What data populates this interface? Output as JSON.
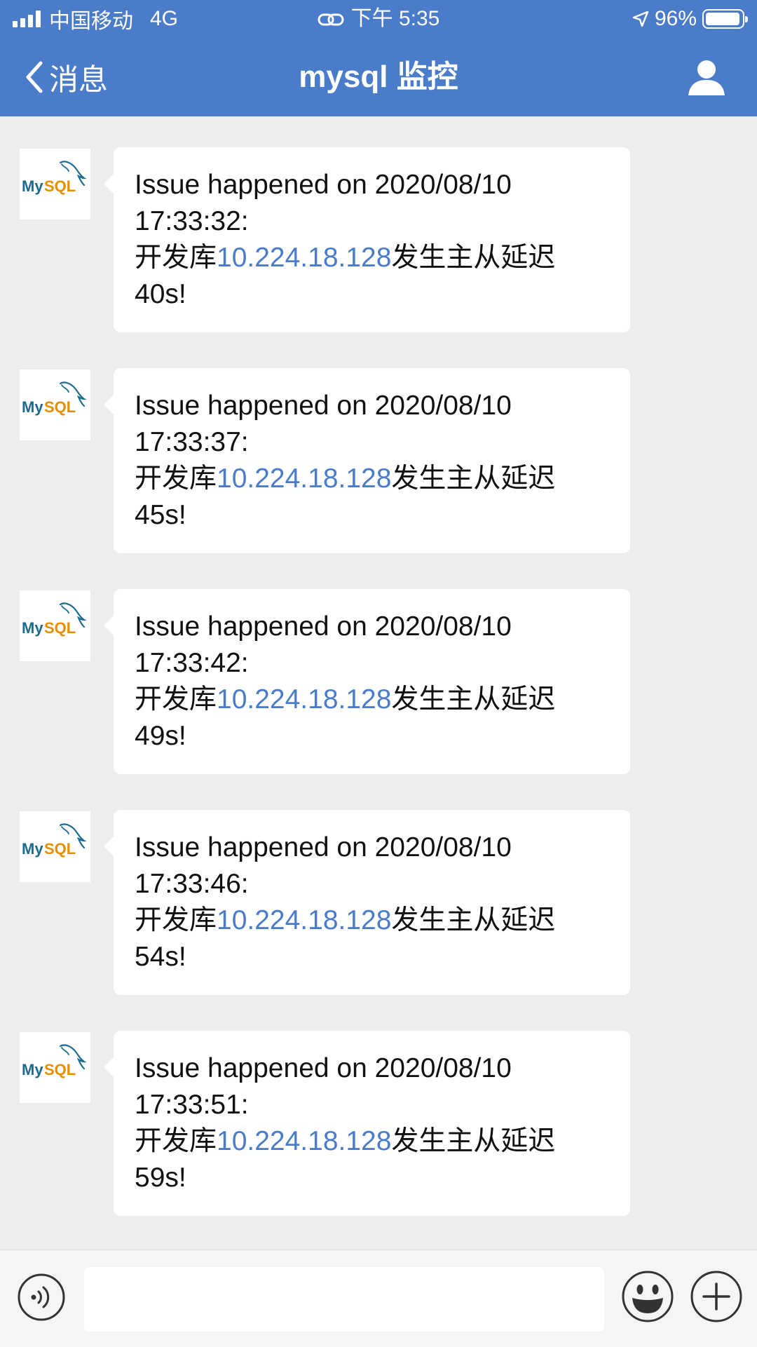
{
  "status_bar": {
    "carrier": "中国移动",
    "network": "4G",
    "time": "下午 5:35",
    "battery": "96%",
    "battery_level": 0.96
  },
  "nav": {
    "back_label": "消息",
    "title": "mysql 监控"
  },
  "avatar_text": "MySQL",
  "messages": [
    {
      "line1": "Issue happened on 2020/08/10",
      "line2": "17:33:32:",
      "prefix": "开发库",
      "ip": "10.224.18.128",
      "suffix": "发生主从延迟",
      "delay": "40s!"
    },
    {
      "line1": "Issue happened on 2020/08/10",
      "line2": "17:33:37:",
      "prefix": "开发库",
      "ip": "10.224.18.128",
      "suffix": "发生主从延迟",
      "delay": "45s!"
    },
    {
      "line1": "Issue happened on 2020/08/10",
      "line2": "17:33:42:",
      "prefix": "开发库",
      "ip": "10.224.18.128",
      "suffix": "发生主从延迟",
      "delay": "49s!"
    },
    {
      "line1": "Issue happened on 2020/08/10",
      "line2": "17:33:46:",
      "prefix": "开发库",
      "ip": "10.224.18.128",
      "suffix": "发生主从延迟",
      "delay": "54s!"
    },
    {
      "line1": "Issue happened on 2020/08/10",
      "line2": "17:33:51:",
      "prefix": "开发库",
      "ip": "10.224.18.128",
      "suffix": "发生主从延迟",
      "delay": "59s!"
    }
  ],
  "input": {
    "value": "",
    "placeholder": ""
  },
  "icons": {
    "back": "chevron-left-icon",
    "profile": "user-icon",
    "voice": "voice-icon",
    "emoji": "emoji-icon",
    "plus": "plus-icon"
  },
  "colors": {
    "header": "#4a7cc9",
    "background": "#ededed",
    "link": "#4a7cc9",
    "mysql_blue": "#1b6a8f",
    "mysql_orange": "#e48e00"
  }
}
